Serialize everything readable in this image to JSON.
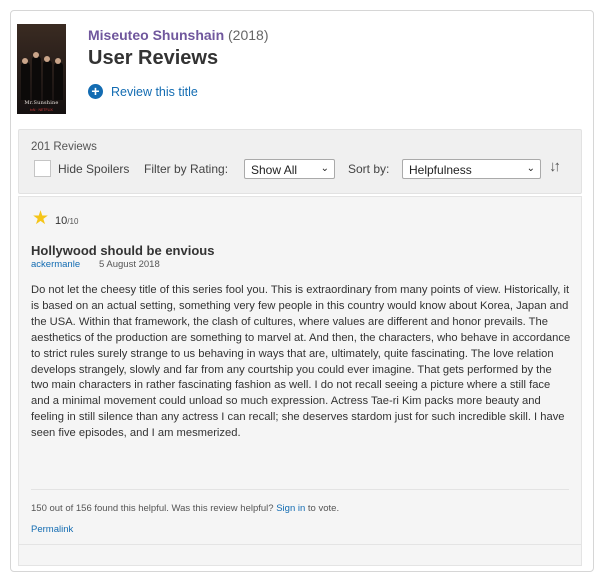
{
  "header": {
    "series_name": "Miseuteo Shunshain",
    "series_year": "(2018)",
    "page_title": "User Reviews",
    "review_this_title": "Review this title",
    "poster": {
      "title_text": "Mr.Sunshine",
      "network_text": "tvN · NETFLIX"
    }
  },
  "filters": {
    "review_count": "201 Reviews",
    "hide_spoilers_label": "Hide Spoilers",
    "filter_by_rating_label": "Filter by Rating:",
    "rating_selected": "Show All",
    "sort_by_label": "Sort by:",
    "sort_selected": "Helpfulness"
  },
  "review": {
    "rating_value": "10",
    "rating_max": "/10",
    "title": "Hollywood should be envious",
    "author": "ackermanle",
    "date": "5 August 2018",
    "text": "Do not let the cheesy title of this series fool you. This is extraordinary from many points of view. Historically, it is based on an actual setting, something very few people in this country would know about Korea, Japan and the USA. Within that framework, the clash of cultures, where values are different and honor prevails. The aesthetics of the production are something to marvel at. And then, the characters, who behave in accordance to strict rules surely strange to us behaving in ways that are, ultimately, quite fascinating. The love relation develops strangely, slowly and far from any courtship you could ever imagine. That gets performed by the two main characters in rather fascinating fashion as well. I do not recall seeing a picture where a still face and a minimal movement could unload so much expression. Actress Tae-ri Kim packs more beauty and feeling in still silence than any actress I can recall; she deserves stardom just for such incredible skill. I have seen five episodes, and I am mesmerized.",
    "helpful_text": "150 out of 156 found this helpful. Was this review helpful?",
    "sign_in": "Sign in",
    "to_vote": "to vote.",
    "permalink": "Permalink"
  },
  "icons": {
    "star": "star-icon",
    "add": "plus-circle-icon",
    "dropdown": "chevron-down-icon",
    "sort_direction": "sort-arrows-icon"
  },
  "colors": {
    "link_blue": "#136cb2",
    "series_purple": "#70579d",
    "star_gold": "#f5c518"
  }
}
